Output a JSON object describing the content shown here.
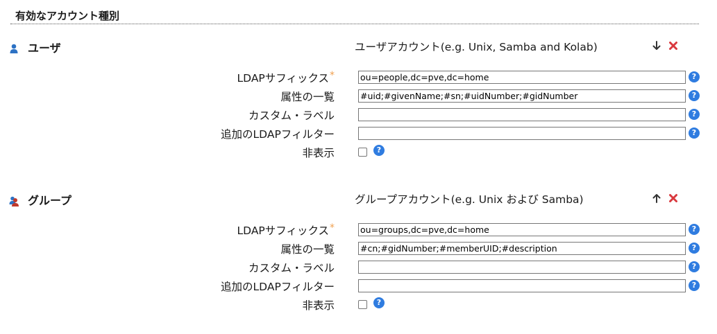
{
  "section": {
    "title": "有効なアカウント種別"
  },
  "colors": {
    "help": "#2f7ce0",
    "delete": "#d9393e",
    "required": "#f0a050"
  },
  "account_types": [
    {
      "name": "ユーザ",
      "description": "ユーザアカウント(e.g. Unix, Samba and Kolab)",
      "icon": "user-icon",
      "move_icon": "arrow-down-icon",
      "fields": {
        "ldap_suffix": {
          "label": "LDAPサフィックス",
          "required_mark": "*",
          "value": "ou=people,dc=pve,dc=home"
        },
        "attributes": {
          "label": "属性の一覧",
          "value": "#uid;#givenName;#sn;#uidNumber;#gidNumber"
        },
        "custom_label": {
          "label": "カスタム・ラベル",
          "value": ""
        },
        "ldap_filter": {
          "label": "追加のLDAPフィルター",
          "value": ""
        },
        "hidden": {
          "label": "非表示",
          "checked": false
        }
      }
    },
    {
      "name": "グループ",
      "description": "グループアカウント(e.g. Unix および Samba)",
      "icon": "group-icon",
      "move_icon": "arrow-up-icon",
      "fields": {
        "ldap_suffix": {
          "label": "LDAPサフィックス",
          "required_mark": "*",
          "value": "ou=groups,dc=pve,dc=home"
        },
        "attributes": {
          "label": "属性の一覧",
          "value": "#cn;#gidNumber;#memberUID;#description"
        },
        "custom_label": {
          "label": "カスタム・ラベル",
          "value": ""
        },
        "ldap_filter": {
          "label": "追加のLDAPフィルター",
          "value": ""
        },
        "hidden": {
          "label": "非表示",
          "checked": false
        }
      }
    }
  ],
  "help": {
    "glyph": "?"
  }
}
